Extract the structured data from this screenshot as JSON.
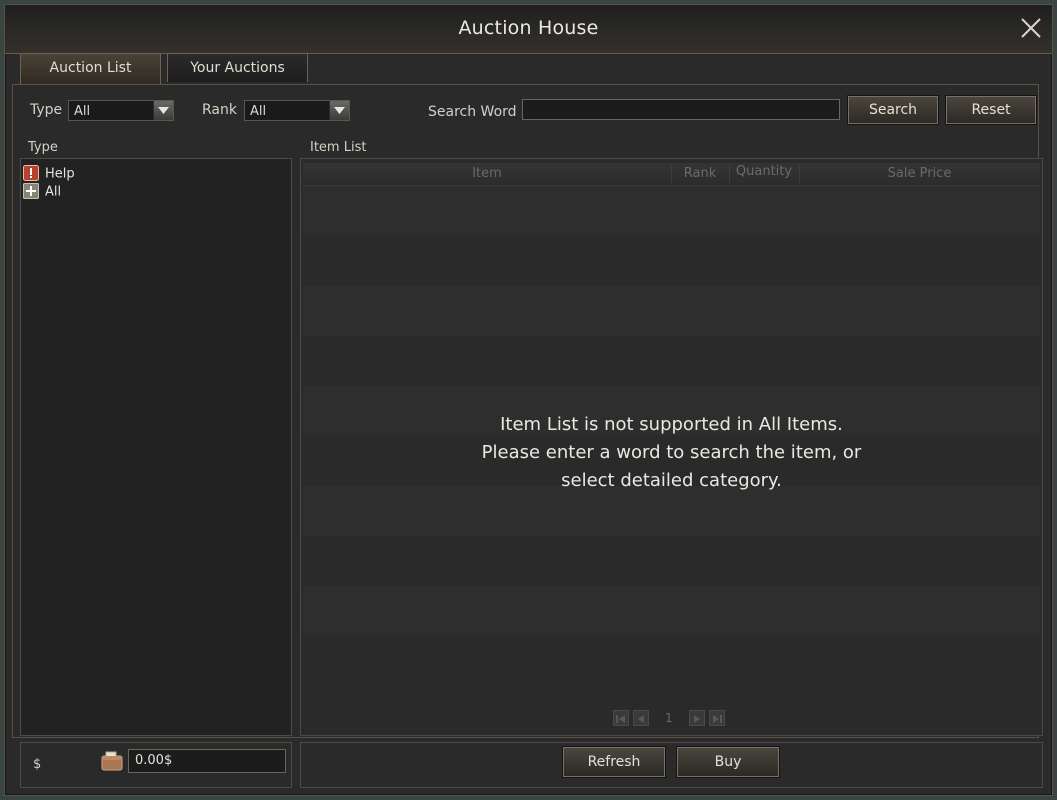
{
  "window": {
    "title": "Auction House"
  },
  "tabs": [
    {
      "label": "Auction List",
      "active": true
    },
    {
      "label": "Your Auctions",
      "active": false
    }
  ],
  "filters": {
    "type_label": "Type",
    "type_value": "All",
    "rank_label": "Rank",
    "rank_value": "All",
    "search_label": "Search Word",
    "search_value": "",
    "search_button": "Search",
    "reset_button": "Reset"
  },
  "left_panel": {
    "label": "Type",
    "items": [
      {
        "label": "Help",
        "icon": "exclamation-icon"
      },
      {
        "label": "All",
        "icon": "plus-expand-icon"
      }
    ]
  },
  "item_list": {
    "label": "Item List",
    "columns": [
      "Item",
      "Rank",
      "Quantity",
      "Sale Price"
    ],
    "message_lines": [
      "Item List is not supported in All Items.",
      "Please enter a word to search the item, or",
      "select detailed category."
    ],
    "page": "1"
  },
  "footer": {
    "currency_label": "$",
    "money_value": "0.00$",
    "refresh_button": "Refresh",
    "buy_button": "Buy"
  },
  "colors": {
    "window_bg": "#2a2a2a",
    "border_accent": "#6e6250",
    "help_icon": "#b8402e"
  }
}
